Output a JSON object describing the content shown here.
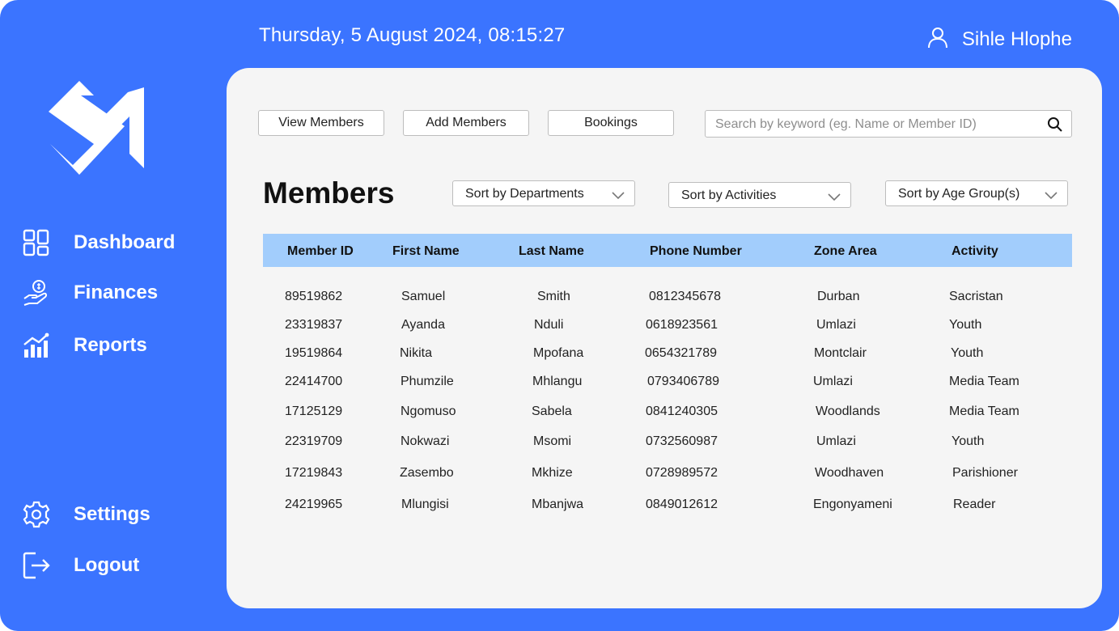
{
  "header": {
    "datetime": "Thursday, 5 August 2024, 08:15:27",
    "user_name": "Sihle Hlophe"
  },
  "sidebar": {
    "items": [
      {
        "label": "Dashboard",
        "icon": "dashboard-icon"
      },
      {
        "label": "Finances",
        "icon": "hand-coin-icon"
      },
      {
        "label": "Reports",
        "icon": "bar-chart-icon"
      },
      {
        "label": "Settings",
        "icon": "gear-icon"
      },
      {
        "label": "Logout",
        "icon": "logout-icon"
      }
    ]
  },
  "toolbar": {
    "view_members": "View Members",
    "add_members": "Add Members",
    "bookings": "Bookings",
    "search_placeholder": "Search by keyword (eg. Name or Member ID)"
  },
  "main": {
    "title": "Members",
    "filters": {
      "departments": "Sort by Departments",
      "activities": "Sort by Activities",
      "age_groups": "Sort by Age Group(s)"
    }
  },
  "table": {
    "columns": [
      "Member ID",
      "First Name",
      "Last Name",
      "Phone Number",
      "Zone Area",
      "Activity"
    ],
    "rows": [
      [
        "89519862",
        "Samuel",
        "Smith",
        "0812345678",
        "Durban",
        "Sacristan"
      ],
      [
        "23319837",
        "Ayanda",
        "Nduli",
        "0618923561",
        "Umlazi",
        "Youth"
      ],
      [
        "19519864",
        "Nikita",
        "Mpofana",
        "0654321789",
        "Montclair",
        "Youth"
      ],
      [
        "22414700",
        "Phumzile",
        "Mhlangu",
        "0793406789",
        "Umlazi",
        "Media Team"
      ],
      [
        "17125129",
        "Ngomuso",
        "Sabela",
        "0841240305",
        "Woodlands",
        "Media Team"
      ],
      [
        "22319709",
        "Nokwazi",
        "Msomi",
        "0732560987",
        "Umlazi",
        "Youth"
      ],
      [
        "17219843",
        "Zasembo",
        "Mkhize",
        "0728989572",
        "Woodhaven",
        "Parishioner"
      ],
      [
        "24219965",
        "Mlungisi",
        "Mbanjwa",
        "0849012612",
        "Engonyameni",
        "Reader"
      ]
    ]
  },
  "colors": {
    "brand_blue": "#3b74ff",
    "panel": "#f5f5f5",
    "table_header": "#a2cdfc"
  }
}
